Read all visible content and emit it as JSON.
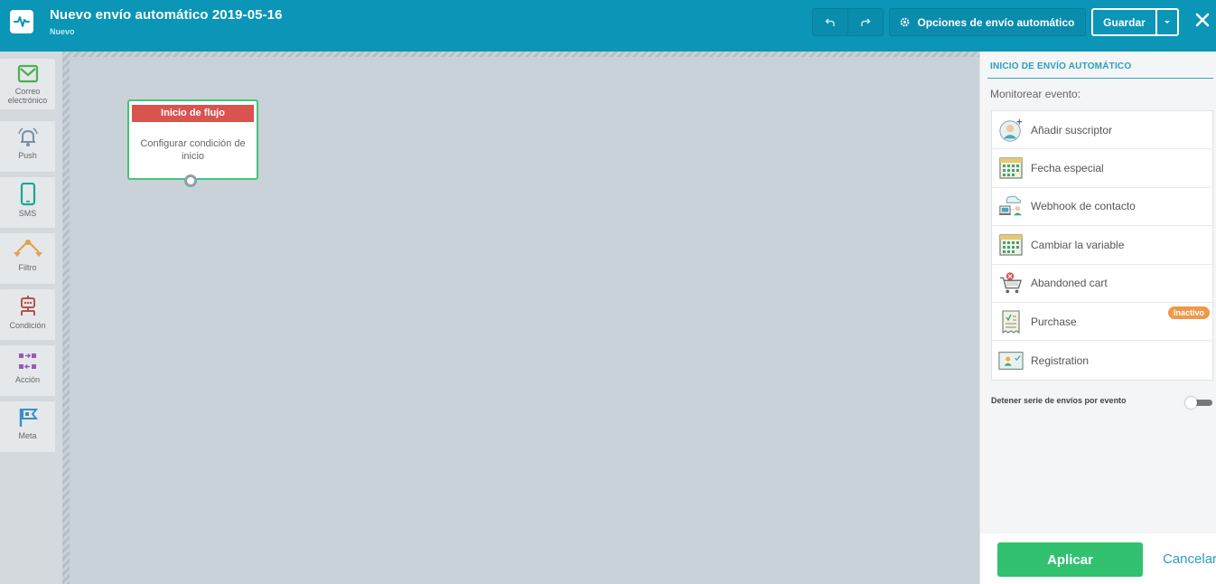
{
  "header": {
    "title": "Nuevo envío automático 2019-05-16",
    "status": "Nuevo",
    "options_label": "Opciones de envío automático",
    "save_label": "Guardar",
    "icons": [
      "activity-icon",
      "undo-icon",
      "redo-icon",
      "gear-icon",
      "caret-down-icon",
      "close-icon"
    ]
  },
  "tools": [
    {
      "label": "Correo electrónico",
      "icon": "mail-icon",
      "color": "#4caf50"
    },
    {
      "label": "Push",
      "icon": "bell-icon",
      "color": "#7890a8"
    },
    {
      "label": "SMS",
      "icon": "phone-icon",
      "color": "#1aa88e"
    },
    {
      "label": "Filtro",
      "icon": "filter-icon",
      "color": "#e0a14a"
    },
    {
      "label": "Condición",
      "icon": "condition-icon",
      "color": "#b85049"
    },
    {
      "label": "Acción",
      "icon": "action-icon",
      "color": "#9b59b6"
    },
    {
      "label": "Meta",
      "icon": "flag-icon",
      "color": "#3a8fc8"
    }
  ],
  "canvas": {
    "node": {
      "header": "Inicio de flujo",
      "body": "Configurar condición de inicio"
    }
  },
  "panel": {
    "title": "INICIO DE ENVÍO AUTOMÁTICO",
    "monitor_label": "Monitorear evento:",
    "events": [
      {
        "label": "Añadir suscriptor",
        "icon": "user-add-icon"
      },
      {
        "label": "Fecha especial",
        "icon": "calendar-icon"
      },
      {
        "label": "Webhook de contacto",
        "icon": "webhook-icon"
      },
      {
        "label": "Cambiar la variable",
        "icon": "calendar-icon"
      },
      {
        "label": "Abandoned cart",
        "icon": "cart-icon"
      },
      {
        "label": "Purchase",
        "icon": "receipt-icon",
        "badge": "Inactivo"
      },
      {
        "label": "Registration",
        "icon": "id-card-icon"
      }
    ],
    "stop_label": "Detener serie de envíos por evento",
    "stop_enabled": false,
    "apply_label": "Aplicar",
    "cancel_label": "Cancelar"
  },
  "colors": {
    "header": "#0b95b7",
    "node_border": "#46c37b",
    "node_header": "#d9534f",
    "apply": "#32c26f",
    "badge": "#f0984a",
    "panel_accent": "#2aa0c0"
  }
}
